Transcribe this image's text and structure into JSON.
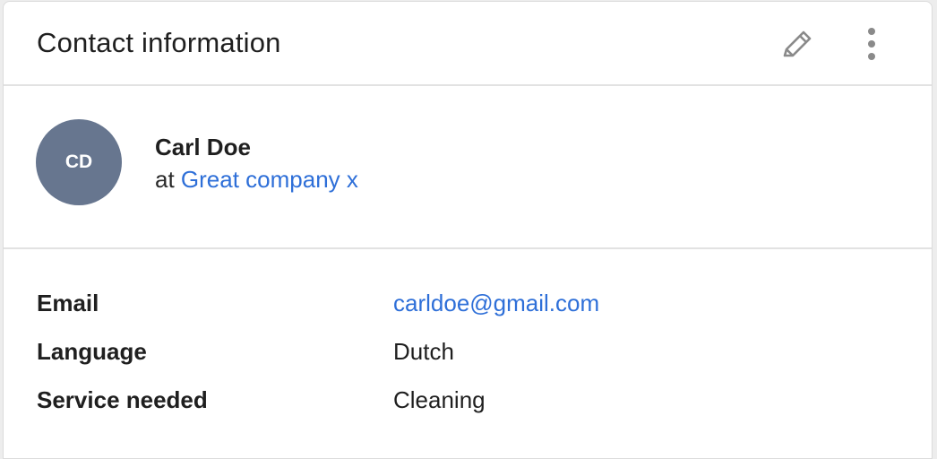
{
  "header": {
    "title": "Contact information",
    "edit_icon": "pencil-icon",
    "more_icon": "vertical-dots-icon"
  },
  "contact": {
    "initials": "CD",
    "name": "Carl Doe",
    "company_prefix": "at",
    "company": "Great company x",
    "avatar_color": "#67768f"
  },
  "details": [
    {
      "label": "Email",
      "value": "carldoe@gmail.com"
    },
    {
      "label": "Language",
      "value": "Dutch"
    },
    {
      "label": "Service needed",
      "value": "Cleaning"
    }
  ],
  "colors": {
    "link": "#2e6fd8",
    "text": "#1f1f1f",
    "divider": "#e2e2e2"
  }
}
